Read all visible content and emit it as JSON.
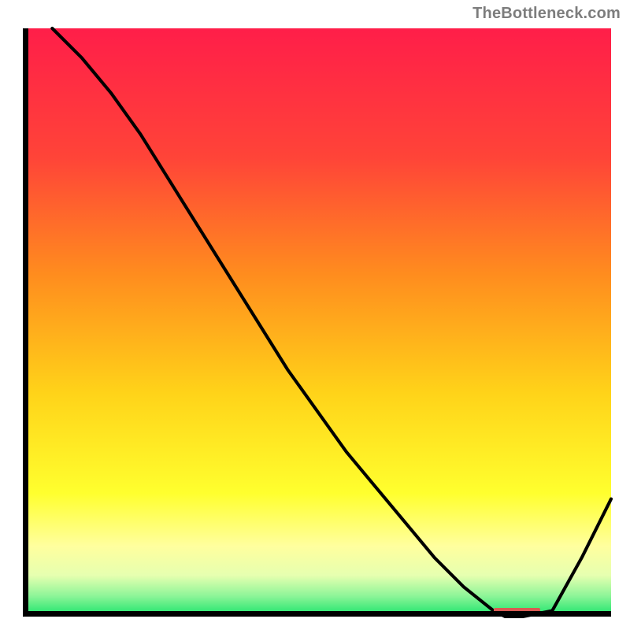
{
  "attribution": "TheBottleneck.com",
  "colors": {
    "gradient_stops": [
      {
        "offset": 0,
        "color": "#ff1e49"
      },
      {
        "offset": 0.22,
        "color": "#ff4438"
      },
      {
        "offset": 0.42,
        "color": "#ff8d1e"
      },
      {
        "offset": 0.62,
        "color": "#ffd319"
      },
      {
        "offset": 0.79,
        "color": "#ffff2e"
      },
      {
        "offset": 0.88,
        "color": "#ffff9e"
      },
      {
        "offset": 0.93,
        "color": "#e6ffb0"
      },
      {
        "offset": 0.965,
        "color": "#8df598"
      },
      {
        "offset": 1.0,
        "color": "#17e36a"
      }
    ],
    "curve": "#000000",
    "axis": "#000000",
    "marker": "#d85a52",
    "attribution_text": "#7d7d7d"
  },
  "chart_data": {
    "type": "line",
    "title": "",
    "xlabel": "",
    "ylabel": "",
    "xlim": [
      0,
      100
    ],
    "ylim": [
      0,
      100
    ],
    "x": [
      5,
      10,
      15,
      20,
      25,
      30,
      35,
      40,
      45,
      50,
      55,
      60,
      65,
      70,
      75,
      80,
      82,
      85,
      90,
      95,
      100
    ],
    "values": [
      100,
      95,
      89,
      82,
      74,
      66,
      58,
      50,
      42,
      35,
      28,
      22,
      16,
      10,
      5,
      1,
      0,
      0,
      1,
      10,
      20
    ],
    "optimum_marker": {
      "x_start": 80,
      "x_end": 88,
      "y": 0
    }
  }
}
